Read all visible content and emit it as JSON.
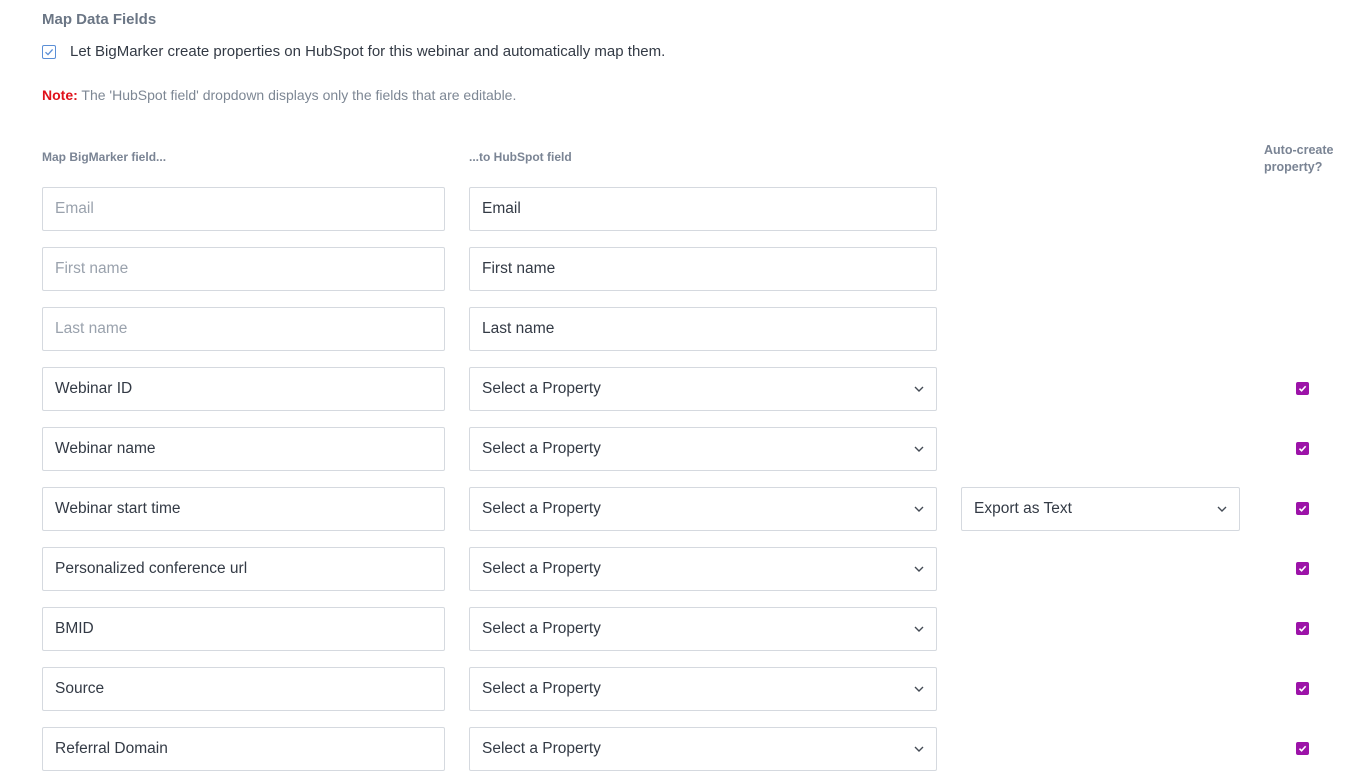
{
  "section": {
    "title": "Map Data Fields",
    "auto_map_label": "Let BigMarker create properties on HubSpot for this webinar and automatically map them.",
    "auto_map_checked": true
  },
  "note": {
    "label": "Note:",
    "text": " The 'HubSpot field' dropdown displays only the fields that are editable."
  },
  "columns": {
    "bigmarker": "Map BigMarker field...",
    "hubspot": "...to HubSpot field",
    "auto_create_line1": "Auto-create",
    "auto_create_line2": "property?"
  },
  "rows": [
    {
      "bigmarker": "Email",
      "bm_is_placeholder": true,
      "hubspot": "Email",
      "hubspot_select": false,
      "auto_create": null
    },
    {
      "bigmarker": "First name",
      "bm_is_placeholder": true,
      "hubspot": "First name",
      "hubspot_select": false,
      "auto_create": null
    },
    {
      "bigmarker": "Last name",
      "bm_is_placeholder": true,
      "hubspot": "Last name",
      "hubspot_select": false,
      "auto_create": null
    },
    {
      "bigmarker": "Webinar ID",
      "bm_is_placeholder": false,
      "hubspot": "Select a Property",
      "hubspot_select": true,
      "auto_create": true
    },
    {
      "bigmarker": "Webinar name",
      "bm_is_placeholder": false,
      "hubspot": "Select a Property",
      "hubspot_select": true,
      "auto_create": true
    },
    {
      "bigmarker": "Webinar start time",
      "bm_is_placeholder": false,
      "hubspot": "Select a Property",
      "hubspot_select": true,
      "export_as": "Export as Text",
      "auto_create": true
    },
    {
      "bigmarker": "Personalized conference url",
      "bm_is_placeholder": false,
      "hubspot": "Select a Property",
      "hubspot_select": true,
      "auto_create": true
    },
    {
      "bigmarker": "BMID",
      "bm_is_placeholder": false,
      "hubspot": "Select a Property",
      "hubspot_select": true,
      "auto_create": true
    },
    {
      "bigmarker": "Source",
      "bm_is_placeholder": false,
      "hubspot": "Select a Property",
      "hubspot_select": true,
      "auto_create": true
    },
    {
      "bigmarker": "Referral Domain",
      "bm_is_placeholder": false,
      "hubspot": "Select a Property",
      "hubspot_select": true,
      "auto_create": true
    }
  ],
  "colors": {
    "accent_checkbox": "#9c13a8",
    "note_red": "#e0111b",
    "outline_blue": "#5b8fd6"
  },
  "icons": {
    "dropdown": "chevron-down-icon",
    "check": "check-icon"
  }
}
